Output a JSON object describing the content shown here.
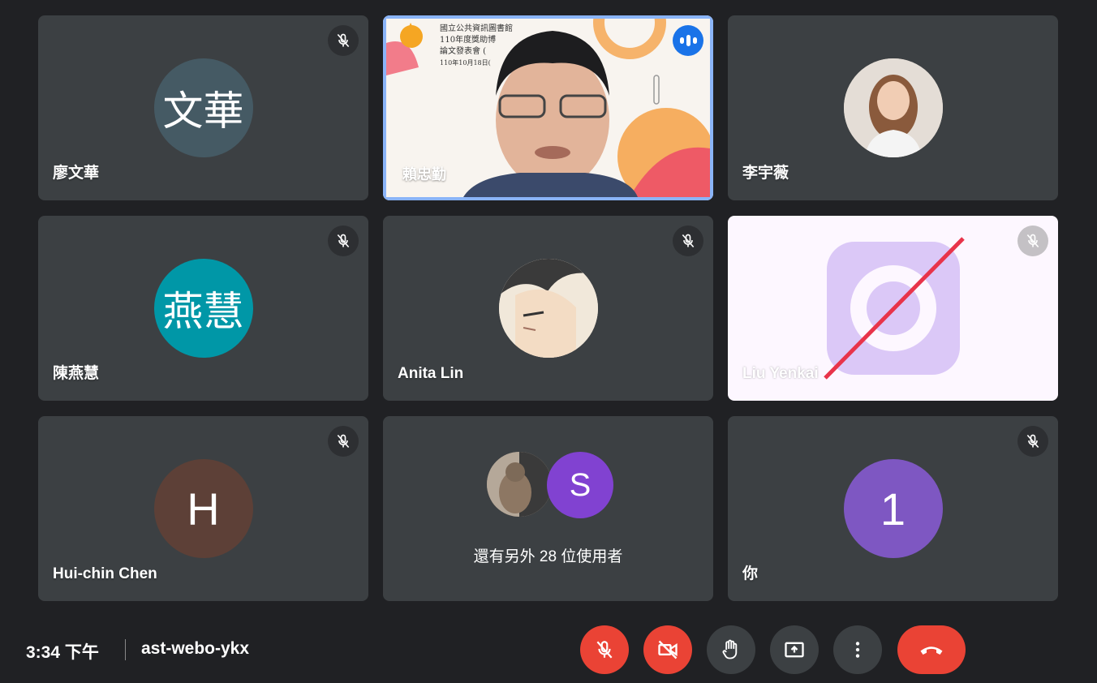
{
  "participants": [
    {
      "name": "廖文華",
      "initials": "文華",
      "avatar_color": "#455a64",
      "muted": true
    },
    {
      "name": "賴忠勤",
      "speaking": true,
      "slide_lines": [
        "國立公共資訊圖書館",
        "110年度獎助博",
        "論文發表會 (",
        "110年10月18日("
      ]
    },
    {
      "name": "李宇薇",
      "avatar_type": "photo",
      "muted": false
    },
    {
      "name": "陳燕慧",
      "initials": "燕慧",
      "avatar_color": "#0097a7",
      "muted": true
    },
    {
      "name": "Anita Lin",
      "avatar_type": "anime-illustration",
      "muted": true
    },
    {
      "name": "Liu Yenkai",
      "avatar_type": "camera-off-icon",
      "muted": true
    },
    {
      "name": "Hui-chin Chen",
      "initials": "H",
      "avatar_color": "#5d4037",
      "muted": true
    },
    {
      "others_text": "還有另外 28 位使用者",
      "extra_initial": "S",
      "extra_color": "#8142d1"
    },
    {
      "name": "你",
      "initials": "1",
      "avatar_color": "#7e57c2",
      "muted": true
    }
  ],
  "footer": {
    "time": "3:34 下午",
    "meeting_code": "ast-webo-ykx"
  },
  "controls": [
    {
      "name": "mic-off",
      "color": "#ea4335"
    },
    {
      "name": "camera-off",
      "color": "#ea4335"
    },
    {
      "name": "raise-hand",
      "color": "#3c4043"
    },
    {
      "name": "present-screen",
      "color": "#3c4043"
    },
    {
      "name": "more-options",
      "color": "#3c4043"
    },
    {
      "name": "leave-call",
      "color": "#ea4335"
    }
  ]
}
